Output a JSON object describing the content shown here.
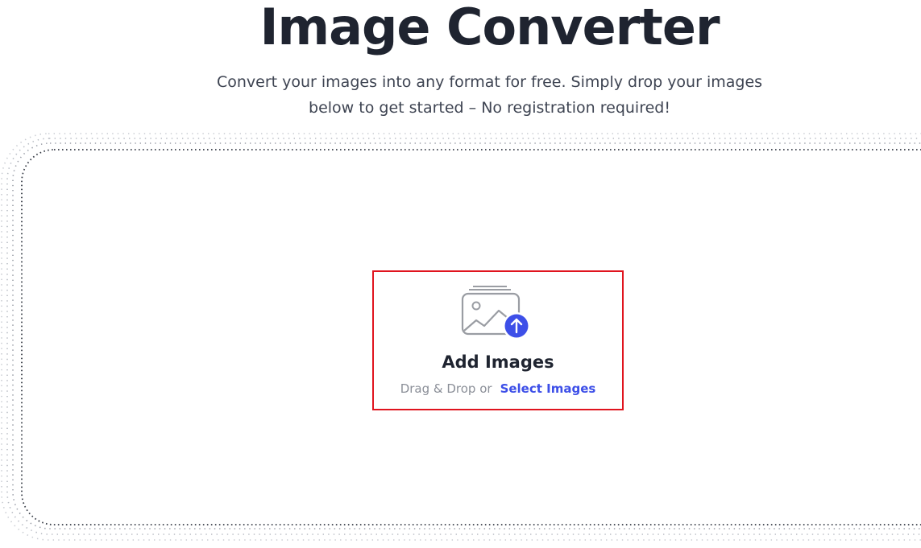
{
  "header": {
    "title": "Image Converter",
    "subtitle_line1": "Convert your images into any format for free. Simply drop your images",
    "subtitle_line2": "below to get started – No registration required!"
  },
  "dropzone": {
    "heading": "Add Images",
    "drag_text": "Drag & Drop or",
    "select_label": "Select Images",
    "icon": "image-upload-icon"
  },
  "colors": {
    "title": "#1f2430",
    "subtitle": "#3e4452",
    "accent": "#3d4fe8",
    "highlight_border": "#e0141e",
    "muted": "#8b8f98"
  }
}
